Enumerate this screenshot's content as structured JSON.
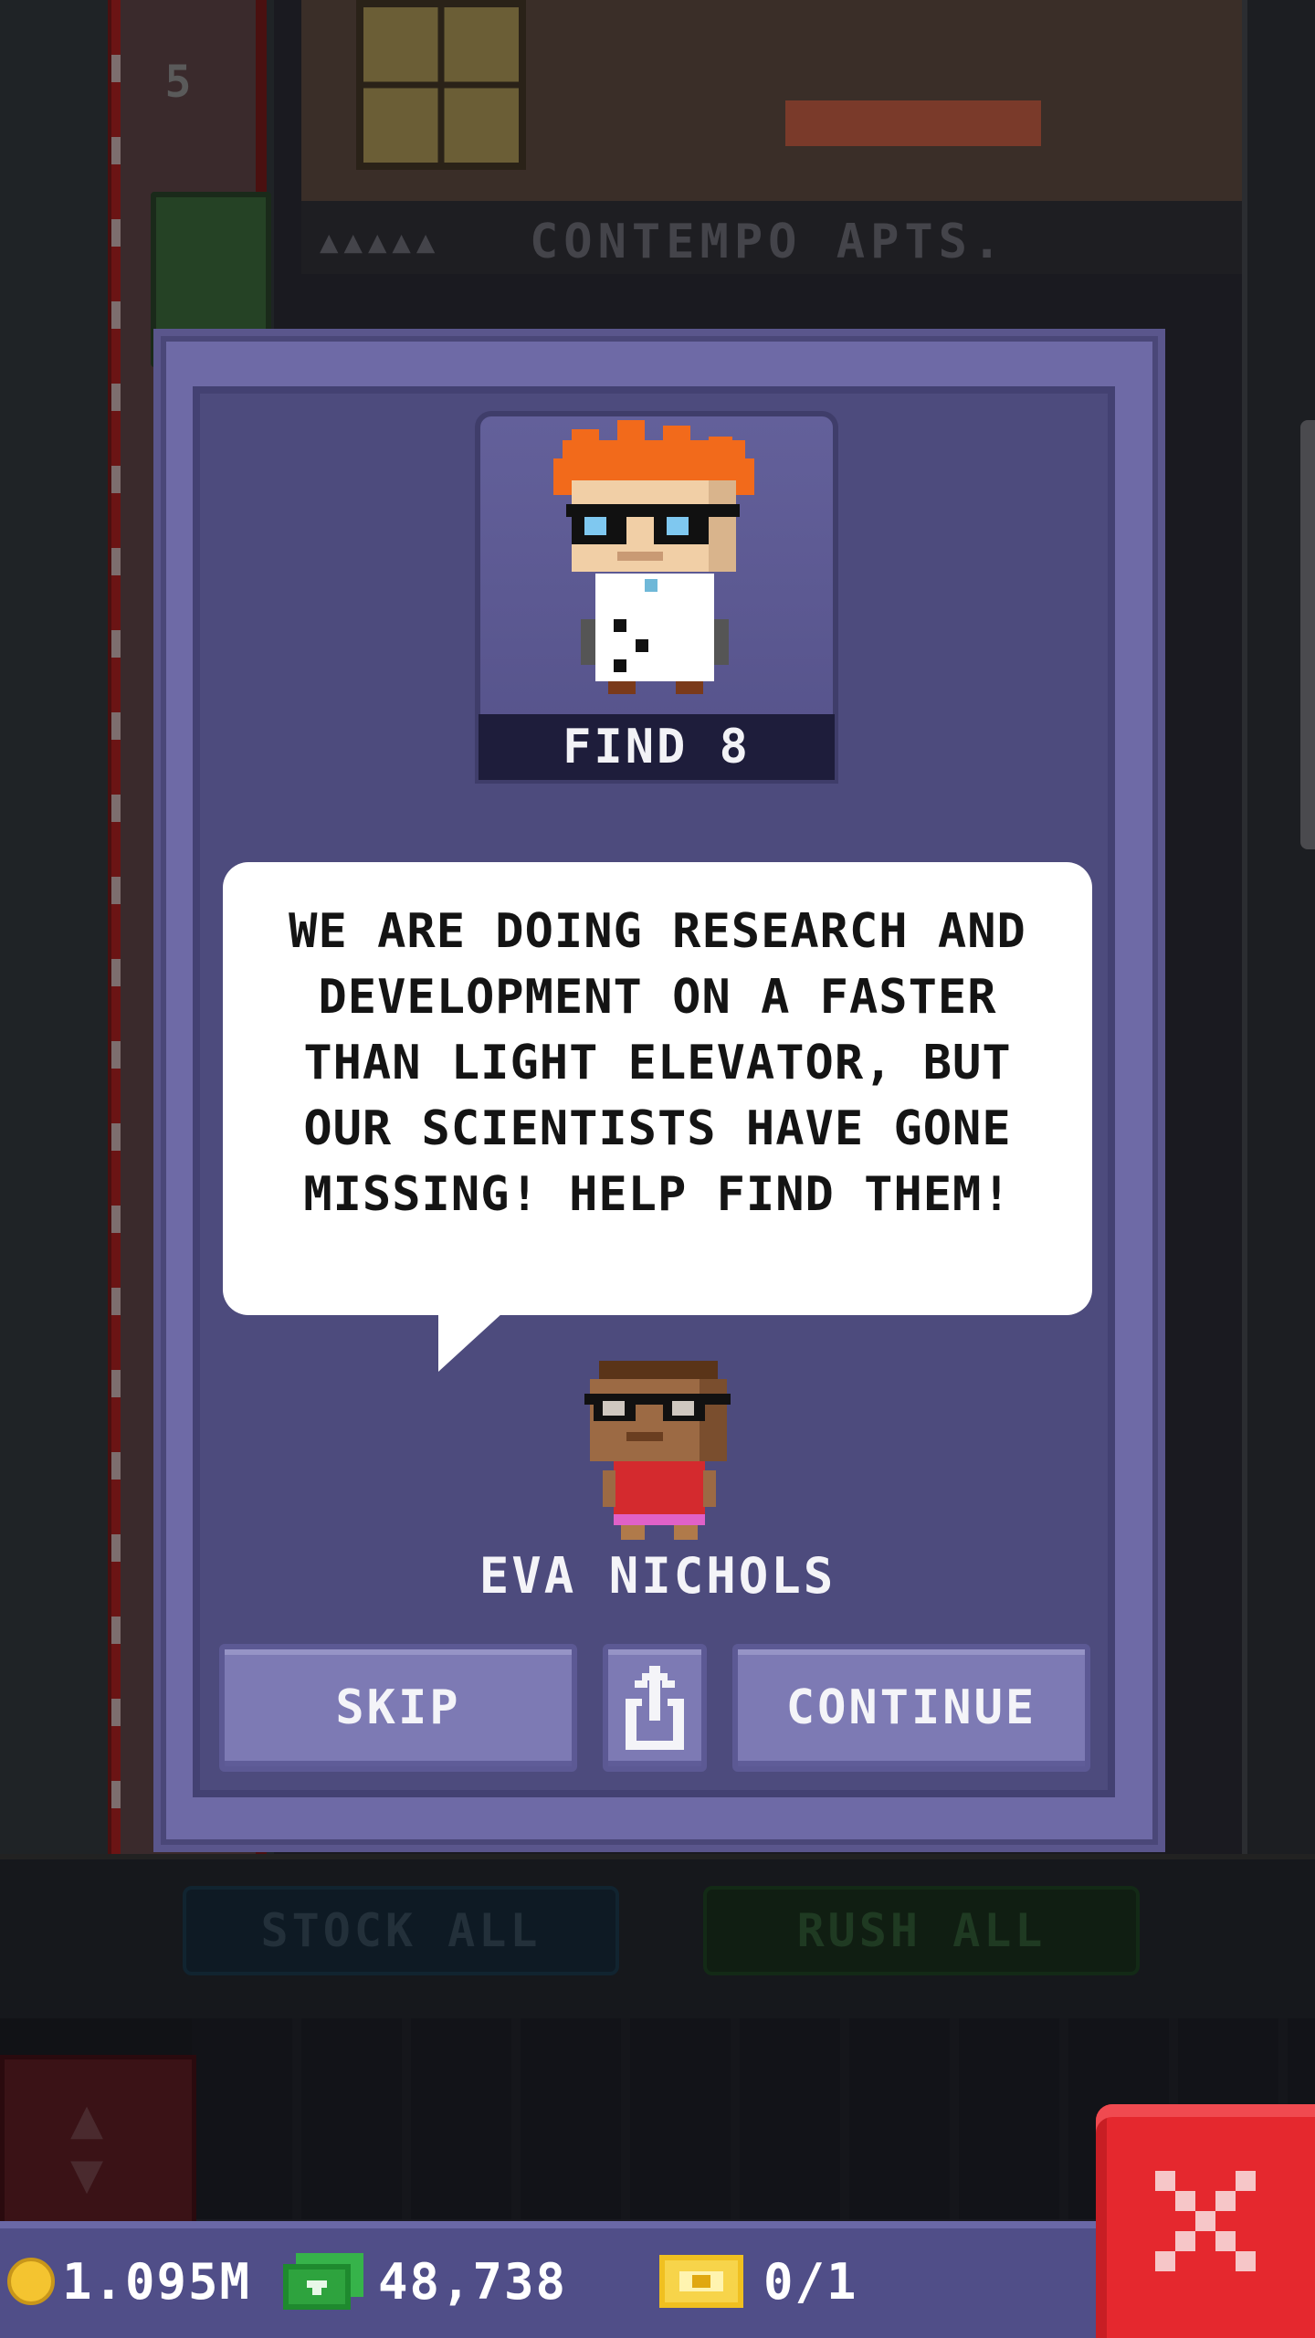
{
  "background": {
    "floor_number": "5",
    "apartment_label": "CONTEMPO APTS.",
    "apartment_occupancy": "▲▲▲▲▲",
    "stock_all_label": "STOCK ALL",
    "rush_all_label": "RUSH ALL"
  },
  "dialog": {
    "portrait_label": "FIND 8",
    "message": "WE ARE DOING RESEARCH AND DEVELOPMENT ON A FASTER THAN LIGHT ELEVATOR, BUT OUR SCIENTISTS HAVE GONE MISSING! HELP FIND THEM!",
    "speaker_name": "EVA NICHOLS",
    "buttons": {
      "skip": "SKIP",
      "continue": "CONTINUE"
    }
  },
  "bottom_bar": {
    "coins": "1.095M",
    "tower_bux": "48,738",
    "tickets": "0/1"
  },
  "icons": {
    "share": "share-icon",
    "close": "close-icon",
    "coin": "coin-icon",
    "bux": "tower-bux-icon",
    "ticket": "golden-ticket-icon"
  },
  "colors": {
    "dialog_bg": "#6e6aa6",
    "dialog_inner": "#4d4b7d",
    "close_red": "#e5282e",
    "bottom_bar": "#504e88"
  }
}
